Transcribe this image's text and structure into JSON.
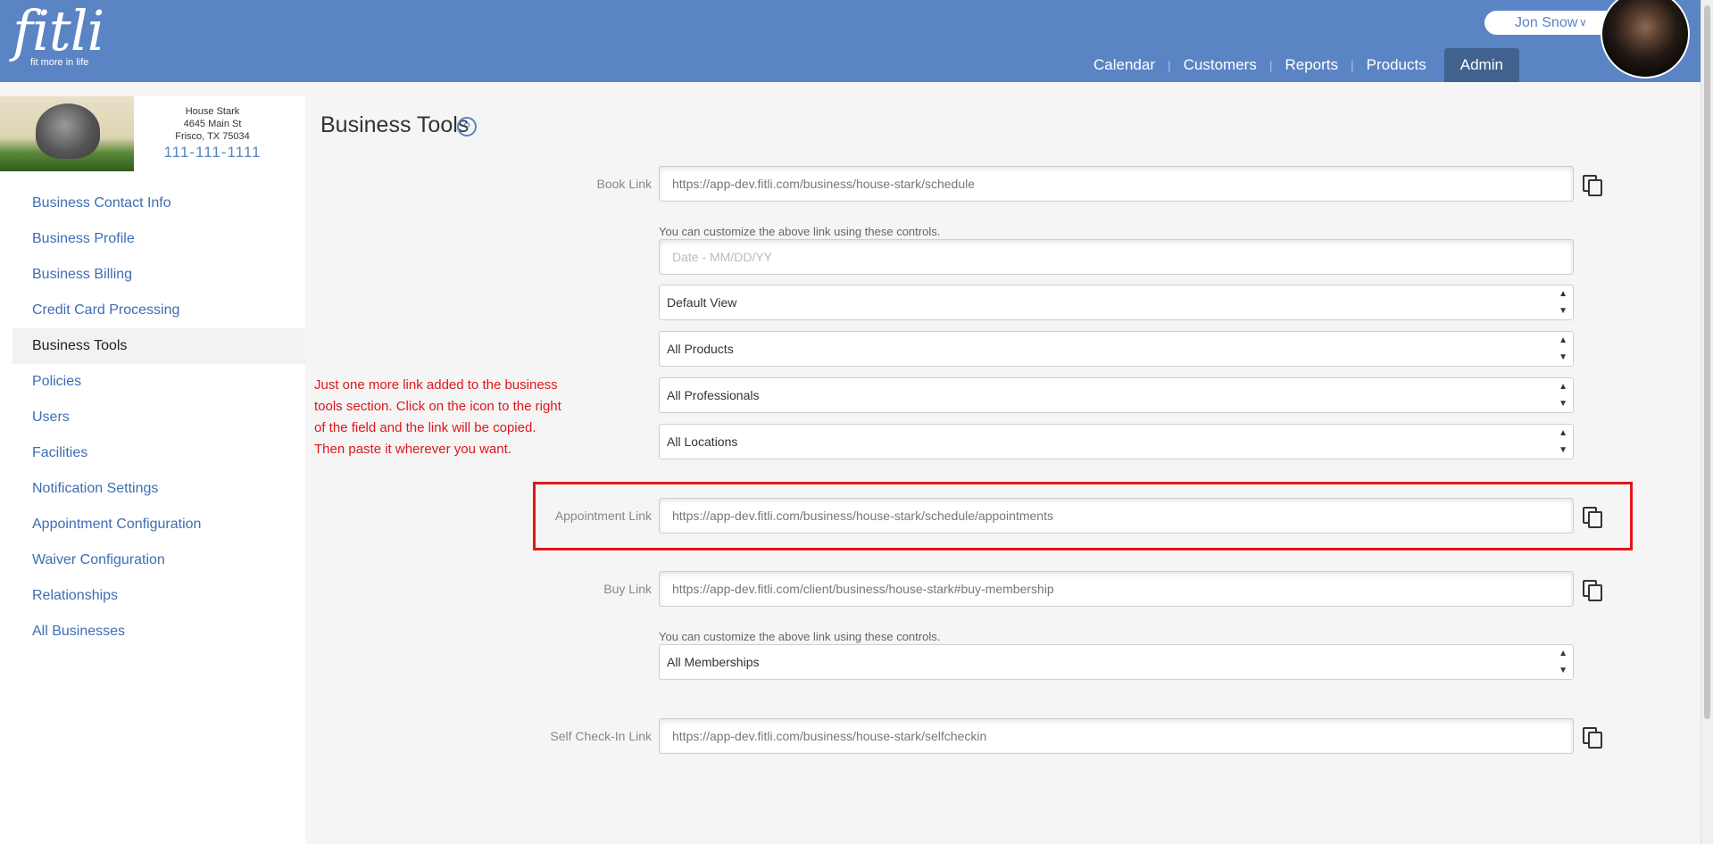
{
  "header": {
    "logo": "fitli",
    "tagline": "fit more in life",
    "user_name": "Jon Snow",
    "nav": [
      "Calendar",
      "Customers",
      "Reports",
      "Products",
      "Admin"
    ],
    "active_nav": "Admin"
  },
  "business": {
    "name": "House Stark",
    "address1": "4645 Main St",
    "address2": "Frisco, TX 75034",
    "phone": "111-111-1111"
  },
  "sidebar": {
    "items": [
      "Business Contact Info",
      "Business Profile",
      "Business Billing",
      "Credit Card Processing",
      "Business Tools",
      "Policies",
      "Users",
      "Facilities",
      "Notification Settings",
      "Appointment Configuration",
      "Waiver Configuration",
      "Relationships",
      "All Businesses"
    ],
    "active": "Business Tools"
  },
  "main": {
    "title": "Business Tools",
    "help": "?",
    "book_link": {
      "label": "Book Link",
      "value": "https://app-dev.fitli.com/business/house-stark/schedule"
    },
    "customize_text": "You can customize the above link using these controls.",
    "date_placeholder": "Date - MM/DD/YY",
    "selects": {
      "view": "Default View",
      "products": "All Products",
      "professionals": "All Professionals",
      "locations": "All Locations"
    },
    "appointment_link": {
      "label": "Appointment Link",
      "value": "https://app-dev.fitli.com/business/house-stark/schedule/appointments"
    },
    "buy_link": {
      "label": "Buy Link",
      "value": "https://app-dev.fitli.com/client/business/house-stark#buy-membership"
    },
    "memberships_select": "All Memberships",
    "self_checkin_link": {
      "label": "Self Check-In Link",
      "value": "https://app-dev.fitli.com/business/house-stark/selfcheckin"
    }
  },
  "annotation": {
    "line1": "Just one more link added to the business",
    "line2": "tools section.  Click on the icon to the right",
    "line3": "of the field and the link will be copied.",
    "line4": "Then paste it wherever you want.",
    "color": "#e0161b"
  },
  "colors": {
    "header": "#5b84c4",
    "nav_active": "#41628f",
    "link": "#3d6db4"
  }
}
